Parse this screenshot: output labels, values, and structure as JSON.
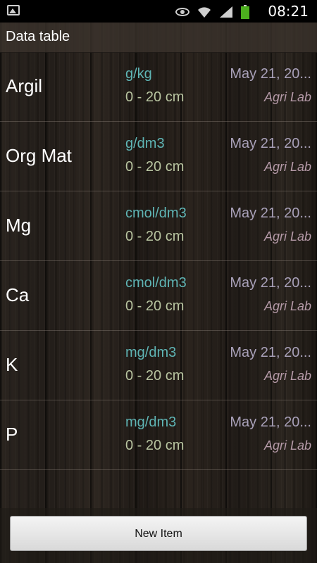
{
  "status_bar": {
    "time": "08:21",
    "icons": [
      "gallery-icon",
      "eye-icon",
      "wifi-icon",
      "signal-icon",
      "battery-icon"
    ],
    "battery_color": "#4caf1e"
  },
  "header": {
    "title": "Data table"
  },
  "rows": [
    {
      "name": "Argil",
      "unit": "g/kg",
      "depth": "0 - 20 cm",
      "date": "May 21, 20...",
      "lab": "Agri Lab"
    },
    {
      "name": "Org Mat",
      "unit": "g/dm3",
      "depth": "0 - 20 cm",
      "date": "May 21, 20...",
      "lab": "Agri Lab"
    },
    {
      "name": "Mg",
      "unit": "cmol/dm3",
      "depth": "0 - 20 cm",
      "date": "May 21, 20...",
      "lab": "Agri Lab"
    },
    {
      "name": "Ca",
      "unit": "cmol/dm3",
      "depth": "0 - 20 cm",
      "date": "May 21, 20...",
      "lab": "Agri Lab"
    },
    {
      "name": "K",
      "unit": "mg/dm3",
      "depth": "0 - 20 cm",
      "date": "May 21, 20...",
      "lab": "Agri Lab"
    },
    {
      "name": "P",
      "unit": "mg/dm3",
      "depth": "0 - 20 cm",
      "date": "May 21, 20...",
      "lab": "Agri Lab"
    }
  ],
  "footer": {
    "new_item_label": "New Item"
  },
  "colors": {
    "unit_text": "#5fb5b5",
    "depth_text": "#b8c4a0",
    "date_text": "#a8a0b8",
    "lab_text": "#b59aa8"
  }
}
